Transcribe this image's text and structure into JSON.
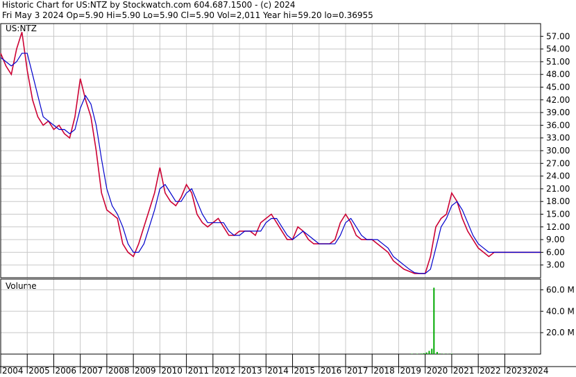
{
  "header": {
    "line1": "Historic Chart for US:NTZ by Stockwatch.com 604.687.1500 - (c) 2024",
    "line2": "Fri May  3 2024   Op=5.90  Hi=5.90  Lo=5.90  Cl=5.90  Vol=2,011   Year hi=59.20   lo=0.36955"
  },
  "symbol": "US:NTZ",
  "volume_label": "Volume",
  "chart_data": [
    {
      "type": "line",
      "name": "price",
      "ylim": [
        0,
        60
      ],
      "yticks": [
        "57.00",
        "54.00",
        "51.00",
        "48.00",
        "45.00",
        "42.00",
        "39.00",
        "36.00",
        "33.00",
        "30.00",
        "27.00",
        "24.00",
        "21.00",
        "18.00",
        "15.00",
        "12.00",
        "9.00",
        "6.00",
        "3.00"
      ],
      "ytick_values": [
        57,
        54,
        51,
        48,
        45,
        42,
        39,
        36,
        33,
        30,
        27,
        24,
        21,
        18,
        15,
        12,
        9,
        6,
        3
      ],
      "xlim": [
        2004.0,
        2024.35
      ],
      "xticks": [
        "2004",
        "2005",
        "2006",
        "2007",
        "2008",
        "2009",
        "2010",
        "2011",
        "2012",
        "2013",
        "2014",
        "2015",
        "2016",
        "2017",
        "2018",
        "2019",
        "2020",
        "2021",
        "2022",
        "20232024"
      ],
      "xtick_positions": [
        2004,
        2005,
        2006,
        2007,
        2008,
        2009,
        2010,
        2011,
        2012,
        2013,
        2014,
        2015,
        2016,
        2017,
        2018,
        2019,
        2020,
        2021,
        2022,
        2023
      ],
      "grid": true,
      "x": [
        2004.0,
        2004.2,
        2004.4,
        2004.6,
        2004.8,
        2005.0,
        2005.2,
        2005.4,
        2005.6,
        2005.8,
        2006.0,
        2006.2,
        2006.4,
        2006.6,
        2006.8,
        2007.0,
        2007.2,
        2007.4,
        2007.6,
        2007.8,
        2008.0,
        2008.2,
        2008.4,
        2008.6,
        2008.8,
        2009.0,
        2009.2,
        2009.4,
        2009.6,
        2009.8,
        2010.0,
        2010.2,
        2010.4,
        2010.6,
        2010.8,
        2011.0,
        2011.2,
        2011.4,
        2011.6,
        2011.8,
        2012.0,
        2012.2,
        2012.4,
        2012.6,
        2012.8,
        2013.0,
        2013.2,
        2013.4,
        2013.6,
        2013.8,
        2014.0,
        2014.2,
        2014.4,
        2014.6,
        2014.8,
        2015.0,
        2015.2,
        2015.4,
        2015.6,
        2015.8,
        2016.0,
        2016.2,
        2016.4,
        2016.6,
        2016.8,
        2017.0,
        2017.2,
        2017.4,
        2017.6,
        2017.8,
        2018.0,
        2018.2,
        2018.4,
        2018.6,
        2018.8,
        2019.0,
        2019.2,
        2019.4,
        2019.6,
        2019.8,
        2020.0,
        2020.2,
        2020.4,
        2020.6,
        2020.8,
        2021.0,
        2021.2,
        2021.4,
        2021.6,
        2021.8,
        2022.0,
        2022.2,
        2022.4,
        2022.6,
        2022.8,
        2023.0,
        2023.2,
        2023.4,
        2023.6,
        2023.8,
        2024.0,
        2024.2,
        2024.35
      ],
      "series": [
        {
          "color": "#cc0033",
          "values": [
            53,
            50,
            48,
            54,
            58,
            49,
            42,
            38,
            36,
            37,
            35,
            36,
            34,
            33,
            38,
            47,
            42,
            38,
            30,
            20,
            16,
            15,
            14,
            8,
            6,
            5,
            8,
            12,
            16,
            20,
            26,
            20,
            18,
            17,
            19,
            22,
            20,
            15,
            13,
            12,
            13,
            14,
            12,
            10,
            10,
            11,
            11,
            11,
            10,
            13,
            14,
            15,
            13,
            11,
            9,
            9,
            12,
            11,
            9,
            8,
            8,
            8,
            8,
            9,
            13,
            15,
            13,
            10,
            9,
            9,
            9,
            8,
            7,
            6,
            4,
            3,
            2,
            1.5,
            1,
            1,
            1,
            5,
            12,
            14,
            15,
            20,
            18,
            14,
            11,
            9,
            7,
            6,
            5,
            6,
            6,
            6,
            6,
            6,
            6,
            6,
            6,
            6,
            6
          ]
        },
        {
          "color": "#0000cc",
          "values": [
            52,
            51,
            50,
            51,
            53,
            53,
            48,
            43,
            38,
            37,
            36,
            35,
            35,
            34,
            35,
            40,
            43,
            41,
            36,
            28,
            21,
            17,
            15,
            12,
            8,
            6,
            6,
            8,
            12,
            16,
            21,
            22,
            20,
            18,
            18,
            20,
            21,
            18,
            15,
            13,
            13,
            13,
            13,
            11,
            10,
            10,
            11,
            11,
            11,
            11,
            13,
            14,
            14,
            12,
            10,
            9,
            10,
            11,
            10,
            9,
            8,
            8,
            8,
            8,
            10,
            13,
            14,
            12,
            10,
            9,
            9,
            9,
            8,
            7,
            5,
            4,
            3,
            2,
            1.2,
            1,
            1,
            2,
            7,
            12,
            14,
            17,
            18,
            16,
            13,
            10,
            8,
            7,
            6,
            6,
            6,
            6,
            6,
            6,
            6,
            6,
            6,
            6,
            6
          ]
        }
      ]
    },
    {
      "type": "bar",
      "name": "volume",
      "ylim": [
        0,
        70
      ],
      "yticks": [
        "60.0 M",
        "40.0 M",
        "20.0 M"
      ],
      "ytick_values": [
        60,
        40,
        20
      ],
      "x": [
        2019.5,
        2019.7,
        2019.85,
        2019.95,
        2020.05,
        2020.15,
        2020.25,
        2020.33,
        2020.45,
        2020.55,
        2020.7,
        2020.85,
        2021.0
      ],
      "values": [
        0.3,
        0.3,
        0.5,
        0.8,
        1.5,
        3,
        5,
        62,
        2,
        0.5,
        0.3,
        0.2,
        0.3
      ],
      "color": "#00aa00"
    }
  ]
}
